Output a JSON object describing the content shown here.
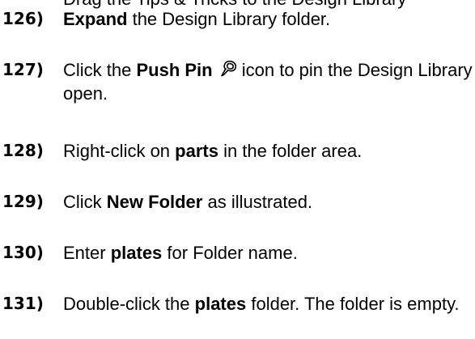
{
  "cropped_line": "Drag the Tips & Tricks to the Design Library",
  "steps": [
    {
      "number": "126)",
      "parts": [
        "",
        "Expand",
        " the Design Library folder."
      ]
    },
    {
      "number": "127)",
      "parts": [
        "Click the ",
        "Push Pin",
        " ",
        "icon to pin the Design Library open."
      ],
      "icon": "push-pin-icon"
    },
    {
      "number": "128)",
      "parts": [
        "Right-click on ",
        "parts",
        " in the folder area."
      ]
    },
    {
      "number": "129)",
      "parts": [
        "Click ",
        "New Folder",
        " as illustrated."
      ]
    },
    {
      "number": "130)",
      "parts": [
        "Enter ",
        "plates",
        " for Folder name."
      ]
    },
    {
      "number": "131)",
      "parts": [
        "Double-click the ",
        "plates",
        " folder. The folder is empty."
      ]
    }
  ],
  "colors": {
    "text": "#000000",
    "background": "#ffffff",
    "pin_fill": "#ffffff",
    "pin_stroke": "#000000"
  }
}
